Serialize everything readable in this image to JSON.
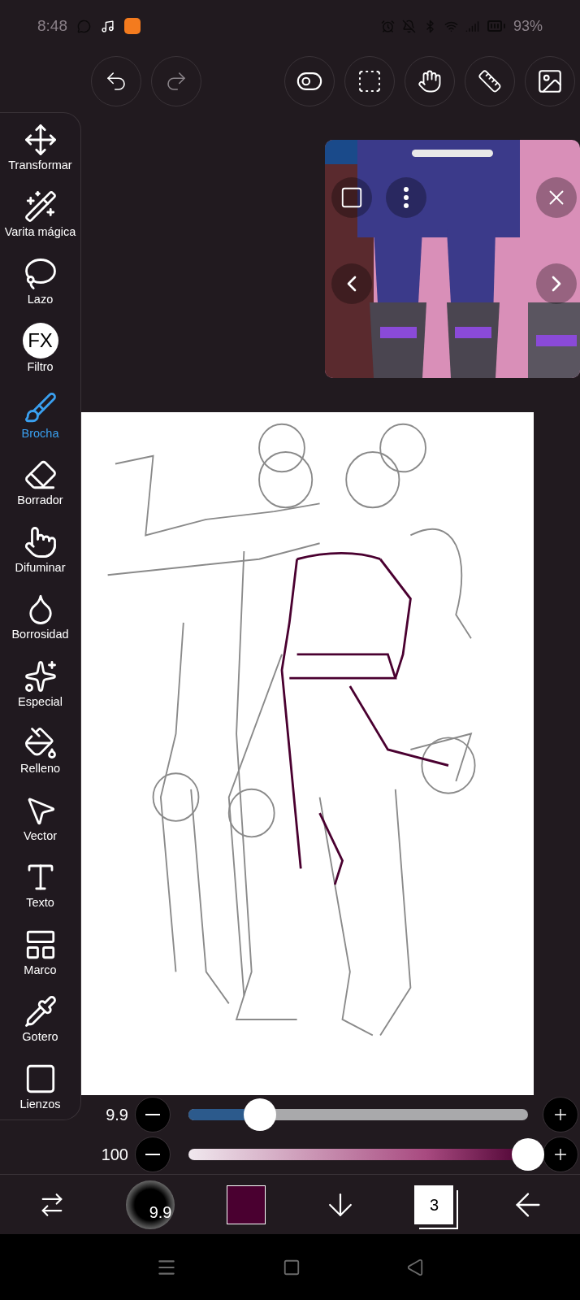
{
  "status_bar": {
    "time": "8:48",
    "battery": "93%"
  },
  "tools": [
    {
      "label": "Transformar",
      "selected": false
    },
    {
      "label": "Varita mágica",
      "selected": false
    },
    {
      "label": "Lazo",
      "selected": false
    },
    {
      "label": "Filtro",
      "selected": false,
      "badge": "FX"
    },
    {
      "label": "Brocha",
      "selected": true
    },
    {
      "label": "Borrador",
      "selected": false
    },
    {
      "label": "Difuminar",
      "selected": false
    },
    {
      "label": "Borrosidad",
      "selected": false
    },
    {
      "label": "Especial",
      "selected": false
    },
    {
      "label": "Relleno",
      "selected": false
    },
    {
      "label": "Vector",
      "selected": false
    },
    {
      "label": "Texto",
      "selected": false
    },
    {
      "label": "Marco",
      "selected": false
    },
    {
      "label": "Gotero",
      "selected": false
    },
    {
      "label": "Lienzos",
      "selected": false
    }
  ],
  "sliders": [
    {
      "kind": "size",
      "reading": "9.9",
      "level": 0.21
    },
    {
      "kind": "opacity",
      "reading": "100",
      "level": 1
    }
  ],
  "bottom_bar": {
    "brush_size": "9.9",
    "color": "#4a0030",
    "layers": "3"
  }
}
